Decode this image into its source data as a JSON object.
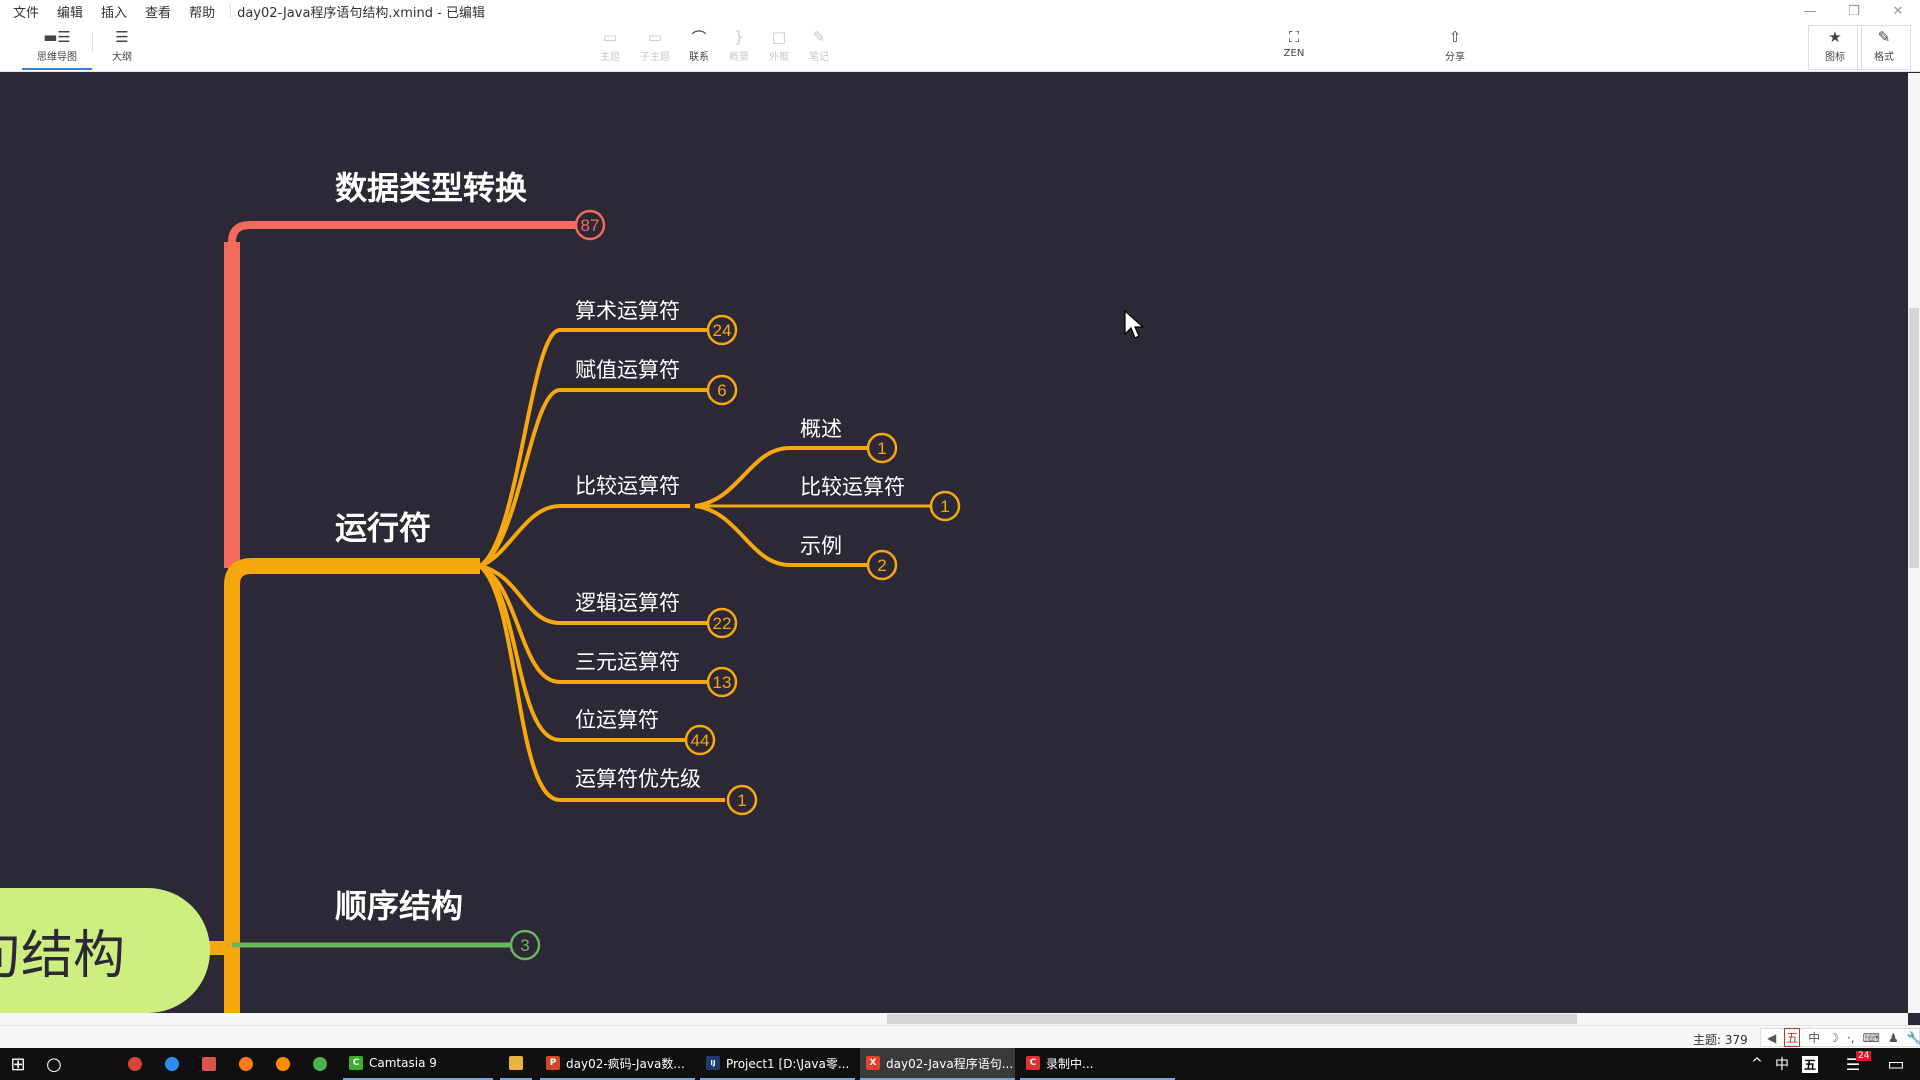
{
  "window": {
    "title": "day02-Java程序语句结构.xmind - 已编辑",
    "menu": [
      "文件",
      "编辑",
      "插入",
      "查看",
      "帮助"
    ],
    "controls": {
      "minimize": "—",
      "restore": "❐",
      "close": "✕"
    }
  },
  "toolbar": {
    "left": [
      {
        "label": "思维导图",
        "icon": "mindmap-icon",
        "glyph": "▬☰",
        "active": true
      },
      {
        "label": "大纲",
        "icon": "outline-icon",
        "glyph": "☰",
        "active": false
      }
    ],
    "center": [
      {
        "label": "主题",
        "icon": "topic-icon",
        "glyph": "▭",
        "enabled": false
      },
      {
        "label": "子主题",
        "icon": "subtopic-icon",
        "glyph": "▭",
        "enabled": false
      },
      {
        "label": "联系",
        "icon": "relationship-icon",
        "glyph": "⌒",
        "enabled": true
      },
      {
        "label": "概要",
        "icon": "summary-icon",
        "glyph": "}",
        "enabled": false
      },
      {
        "label": "外框",
        "icon": "boundary-icon",
        "glyph": "□",
        "enabled": false
      },
      {
        "label": "笔记",
        "icon": "notes-icon",
        "glyph": "✎",
        "enabled": false
      }
    ],
    "zen": {
      "label": "ZEN",
      "icon": "zen-icon",
      "glyph": "⛶"
    },
    "share": {
      "label": "分享",
      "icon": "share-icon",
      "glyph": "⇧"
    },
    "right": [
      {
        "label": "图标",
        "icon": "star-icon",
        "glyph": "★"
      },
      {
        "label": "格式",
        "icon": "brush-icon",
        "glyph": "✎"
      }
    ]
  },
  "mindmap": {
    "central_topic": "句结构",
    "central_color": "#cdef7f",
    "branches": [
      {
        "title": "数据类型转换",
        "count": "87",
        "color": "#f26b5b"
      },
      {
        "title": "运行符",
        "color": "#f5a80f",
        "children": [
          {
            "title": "算术运算符",
            "count": "24"
          },
          {
            "title": "赋值运算符",
            "count": "6"
          },
          {
            "title": "比较运算符",
            "children": [
              {
                "title": "概述",
                "count": "1"
              },
              {
                "title": "比较运算符",
                "count": "1"
              },
              {
                "title": "示例",
                "count": "2"
              }
            ]
          },
          {
            "title": "逻辑运算符",
            "count": "22"
          },
          {
            "title": "三元运算符",
            "count": "13"
          },
          {
            "title": "位运算符",
            "count": "44"
          },
          {
            "title": "运算符优先级",
            "count": "1"
          }
        ]
      },
      {
        "title": "顺序结构",
        "count": "3",
        "color": "#67b85a"
      }
    ]
  },
  "statusbar": {
    "topic_count": "主题: 379",
    "ime": [
      "◀",
      "五",
      "中",
      "☽",
      "·,",
      "⌨",
      "♟",
      "🔧"
    ]
  },
  "taskbar": {
    "pinned": [
      {
        "name": "chrome-icon",
        "color": "#db4437"
      },
      {
        "name": "qq-browser-icon",
        "color": "#2b8ef2"
      },
      {
        "name": "app-icon",
        "color": "#d9534f"
      },
      {
        "name": "firefox-icon",
        "color": "#ff7b1a"
      },
      {
        "name": "search-tool-icon",
        "color": "#ff8c00"
      },
      {
        "name": "green-app-icon",
        "color": "#4caf50"
      }
    ],
    "apps": [
      {
        "label": "Camtasia 9",
        "icon": "C",
        "color": "#3fae2a"
      },
      {
        "label": "",
        "icon": "📁",
        "color": "#e8b43b"
      },
      {
        "label": "day02-疯码-Java数...",
        "icon": "P",
        "color": "#d24726"
      },
      {
        "label": "Project1 [D:\\Java零...",
        "icon": "IJ",
        "color": "#1e3a6e"
      },
      {
        "label": "day02-Java程序语句...",
        "icon": "X",
        "color": "#e8412b"
      },
      {
        "label": "录制中...",
        "icon": "C",
        "color": "#e03030"
      }
    ],
    "tray": {
      "chevron": "^",
      "lang": "中",
      "ime": "五",
      "notification_count": "24",
      "action_center": "▭"
    }
  }
}
